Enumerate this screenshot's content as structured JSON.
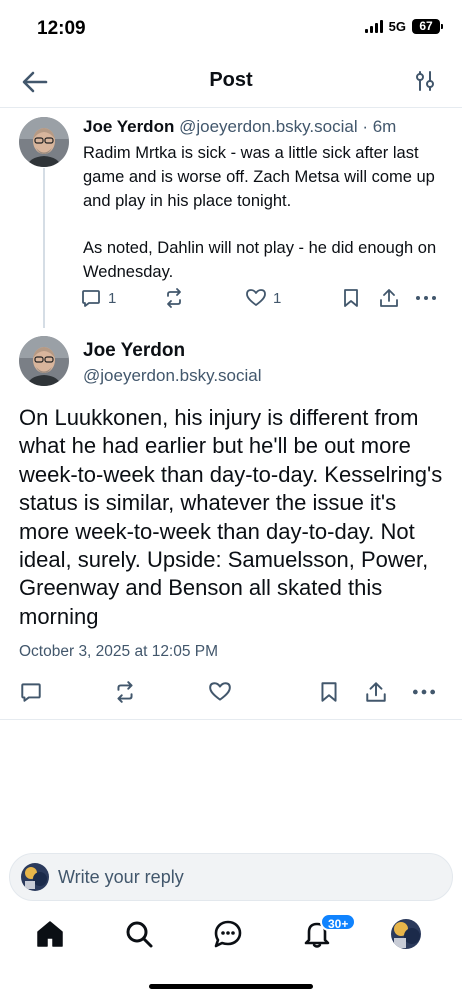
{
  "status_bar": {
    "time": "12:09",
    "network": "5G",
    "battery": "67",
    "icons": [
      "signal-icon",
      "battery-icon"
    ]
  },
  "header": {
    "title": "Post",
    "icons": [
      "back-arrow-icon",
      "filter-settings-icon"
    ]
  },
  "parent_post": {
    "author_name": "Joe Yerdon",
    "handle": "@joeyerdon.bsky.social",
    "time_ago": "· 6m",
    "paragraphs": [
      "Radim Mrtka is sick - was a little sick after last game and is worse off. Zach Metsa will come up and play in his place tonight.",
      "As noted, Dahlin will not play - he did enough on Wednesday."
    ],
    "reply_count": "1",
    "like_count": "1"
  },
  "main_post": {
    "author_name": "Joe Yerdon",
    "handle": "@joeyerdon.bsky.social",
    "text": "On Luukkonen, his injury is different from what he had earlier but he'll be out more week-to-week than day-to-day. Kesselring's status is similar, whatever the issue it's more week-to-week than day-to-day. Not ideal, surely. Upside: Samuelsson, Power, Greenway and Benson all skated this morning",
    "timestamp": "October 3, 2025 at 12:05 PM"
  },
  "reply_bar": {
    "placeholder": "Write your reply"
  },
  "bottom_nav": {
    "items": [
      "home-icon",
      "search-icon",
      "chat-icon",
      "notifications-icon",
      "profile-avatar"
    ],
    "notifications_badge": "30+"
  },
  "colors": {
    "text": "#0b0f14",
    "muted": "#42576c",
    "accent": "#1083fe",
    "divider": "#e6ebf0"
  }
}
